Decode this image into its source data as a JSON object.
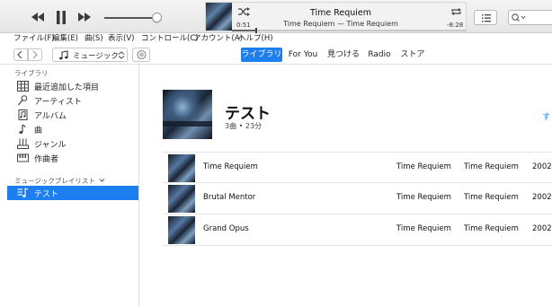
{
  "player": {
    "now_playing_title": "Time Requiem",
    "now_playing_subtitle": "Time Requiem — Time Requiem",
    "elapsed": "0:51",
    "remaining": "-8:28",
    "progress_fraction": 0.1,
    "volume_fraction": 0.9
  },
  "menubar": {
    "items": [
      "ファイル(F)",
      "編集(E)",
      "曲(S)",
      "表示(V)",
      "コントロール(C)",
      "アカウント(A)",
      "ヘルプ(H)"
    ]
  },
  "nav": {
    "media_type": "ミュージック",
    "tabs": [
      "ライブラリ",
      "For You",
      "見つける",
      "Radio",
      "ストア"
    ],
    "active_tab": "ライブラリ"
  },
  "sidebar": {
    "library_header": "ライブラリ",
    "library_items": [
      "最近追加した項目",
      "アーティスト",
      "アルバム",
      "曲",
      "ジャンル",
      "作曲者"
    ],
    "playlists_header": "ミュージックプレイリスト",
    "playlist_items": [
      "テスト"
    ],
    "selected": "テスト",
    "accent_color": "#1d7ef0"
  },
  "playlist": {
    "title": "テスト",
    "meta": "3曲 • 23分",
    "link_partial": "す"
  },
  "tracks": [
    {
      "name": "Time Requiem",
      "artist": "Time Requiem",
      "album": "Time Requiem",
      "year": "2002"
    },
    {
      "name": "Brutal Mentor",
      "artist": "Time Requiem",
      "album": "Time Requiem",
      "year": "2002"
    },
    {
      "name": "Grand Opus",
      "artist": "Time Requiem",
      "album": "Time Requiem",
      "year": "2002"
    }
  ]
}
